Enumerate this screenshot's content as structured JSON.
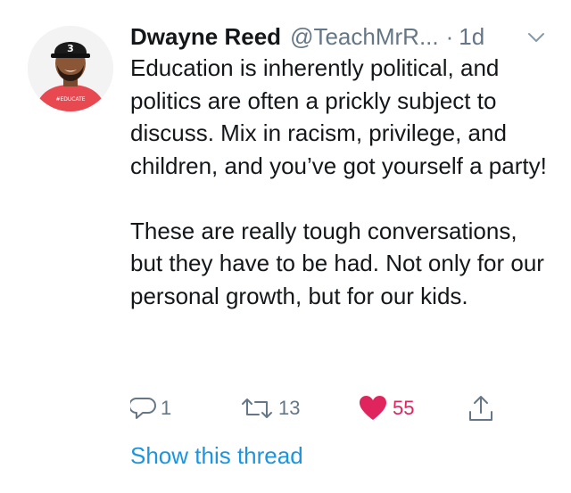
{
  "tweet": {
    "author_name": "Dwayne Reed",
    "author_handle": "@TeachMrR...",
    "separator": "·",
    "timestamp": "1d",
    "paragraphs": [
      "Education is inherently political, and politics are often a prickly subject to discuss. Mix in racism, privilege, and children, and you’ve got yourself a party!",
      "These are really tough conversations, but they have to be had. Not only for our personal growth, but for our kids."
    ],
    "actions": {
      "reply_count": "1",
      "retweet_count": "13",
      "like_count": "55"
    },
    "thread_link": "Show this thread"
  },
  "avatar": {
    "cap_number": "3",
    "shirt_text": "#EDUCATE"
  },
  "icons": {
    "reply": "speech-bubble-icon",
    "retweet": "retweet-arrows-icon",
    "like": "heart-icon",
    "share": "share-upload-icon",
    "menu": "chevron-down-icon"
  },
  "colors": {
    "text": "#14171a",
    "muted": "#657786",
    "link": "#1b95e0",
    "like": "#e0245e",
    "avatar_shirt": "#e8484f"
  }
}
